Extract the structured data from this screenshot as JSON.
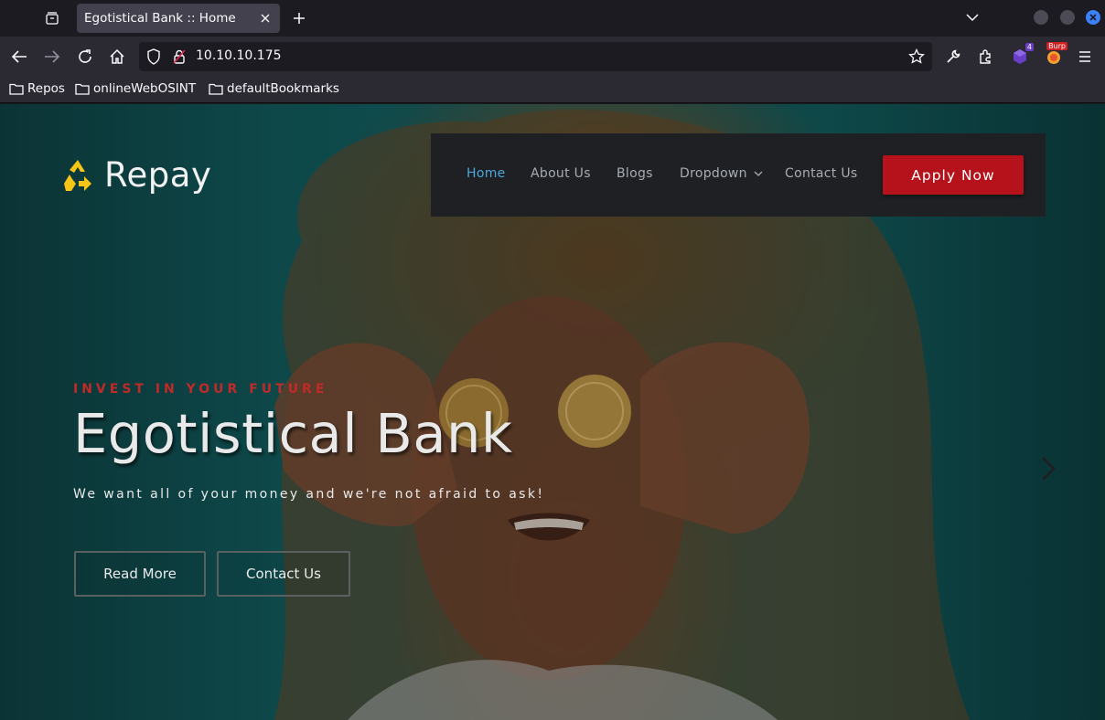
{
  "browser": {
    "tab_title": "Egotistical Bank :: Home",
    "url": "10.10.10.175",
    "bookmarks": [
      "Repos",
      "onlineWebOSINT",
      "defaultBookmarks"
    ],
    "extensions": {
      "ublock_badge": "4",
      "burp_badge": "Burp"
    }
  },
  "site": {
    "logo_text": "Repay",
    "menu": [
      {
        "label": "Home",
        "active": true
      },
      {
        "label": "About Us",
        "active": false
      },
      {
        "label": "Blogs",
        "active": false
      },
      {
        "label": "Dropdown",
        "active": false
      },
      {
        "label": "Contact Us",
        "active": false
      }
    ],
    "apply_label": "Apply Now",
    "hero": {
      "kicker": "INVEST IN YOUR FUTURE",
      "title": "Egotistical Bank",
      "subtitle": "We want all of your money and we're not afraid to ask!",
      "read_more": "Read More",
      "contact": "Contact Us"
    }
  },
  "colors": {
    "accent_blue": "#4ea7d9",
    "apply_red": "#b5121b",
    "kicker_red": "#c02a28",
    "hero_teal": "#146062"
  }
}
